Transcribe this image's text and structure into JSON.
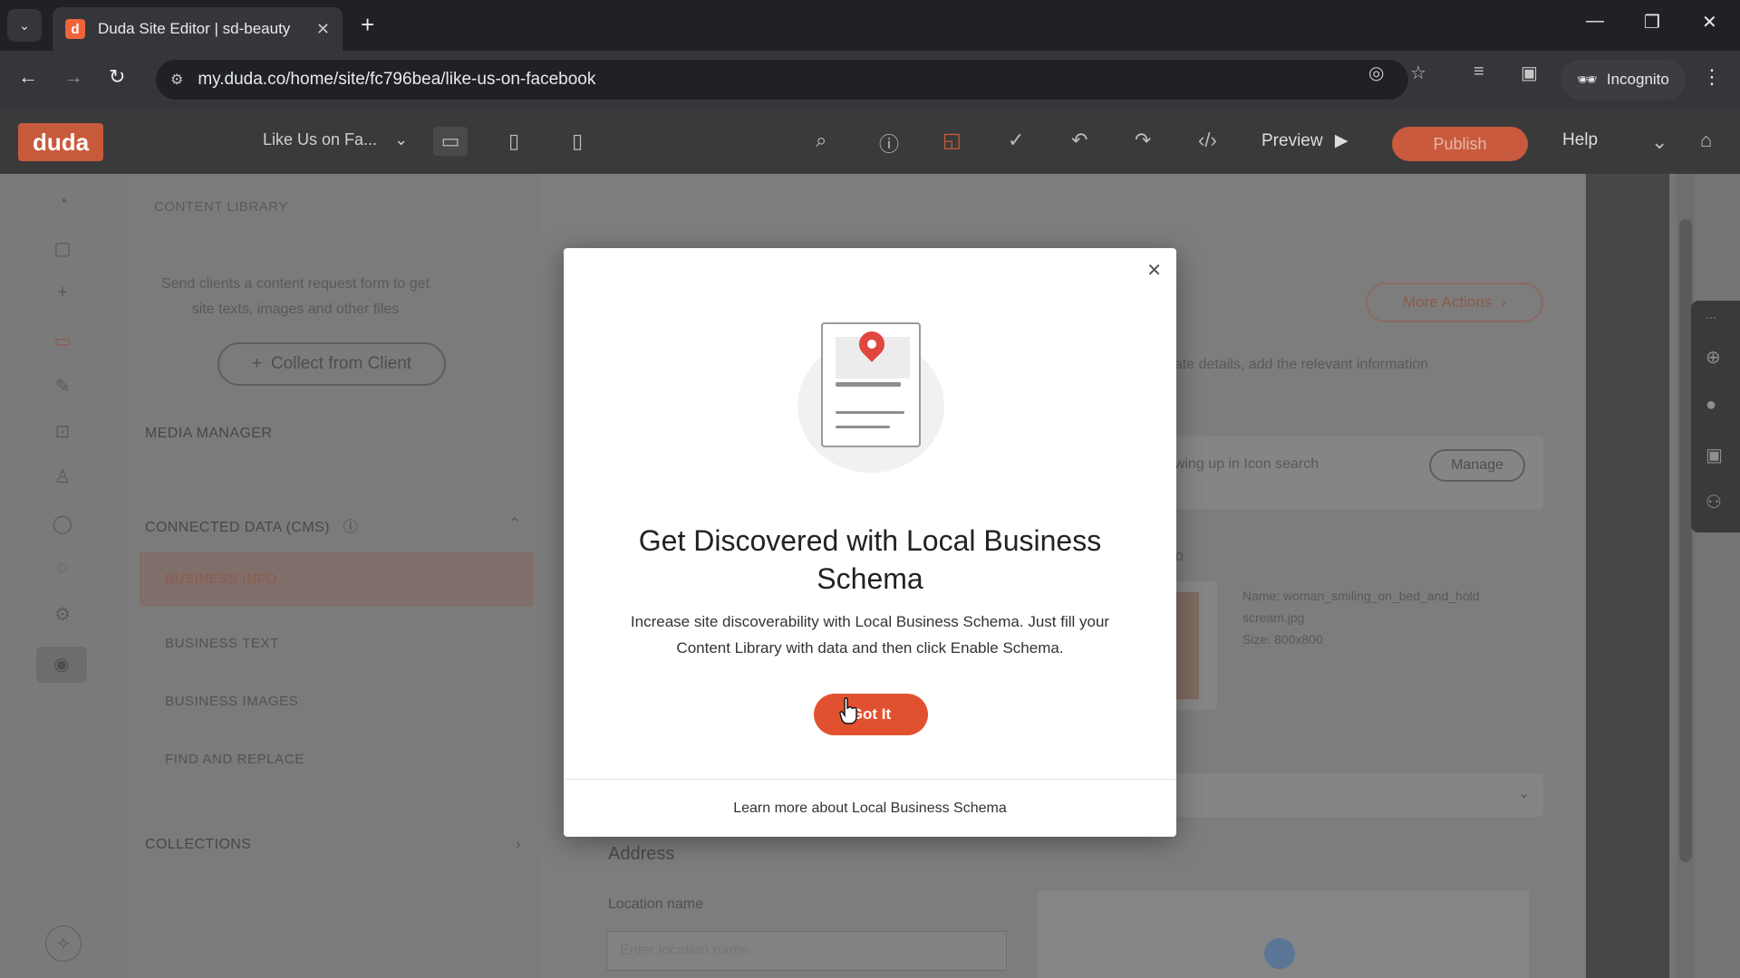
{
  "browser": {
    "tab_title": "Duda Site Editor | sd-beauty",
    "url": "my.duda.co/home/site/fc796bea/like-us-on-facebook",
    "incognito_label": "Incognito"
  },
  "editor": {
    "logo": "duda",
    "page_selector": "Like Us on Fa...",
    "preview_label": "Preview",
    "publish_label": "Publish",
    "help_label": "Help"
  },
  "panel": {
    "header": "CONTENT LIBRARY",
    "subtext": "Send clients a content request form to get site texts, images and other files",
    "collect_button": "Collect from Client",
    "media_manager": "MEDIA MANAGER",
    "connected_data": "CONNECTED DATA (CMS)",
    "items": [
      "BUSINESS INFO",
      "BUSINESS TEXT",
      "BUSINESS IMAGES",
      "FIND AND REPLACE"
    ],
    "collections": "COLLECTIONS"
  },
  "canvas": {
    "more_actions": "More Actions",
    "update_text": "date details, add the relevant information",
    "search_text": "owing up in Icon search",
    "manage_button": "Manage",
    "logo_label": "go",
    "file_info_name": "Name: woman_smiling_on_bed_and_hold",
    "file_info_file": "scream.jpg",
    "file_info_size": "Size: 800x800",
    "address_heading": "Address",
    "location_label": "Location name",
    "location_placeholder": "Enter location name"
  },
  "modal": {
    "title": "Get Discovered with Local Business Schema",
    "description": "Increase site discoverability with Local Business Schema. Just fill your Content Library with data and then click Enable Schema.",
    "button": "Got It",
    "footer_link": "Learn more about Local Business Schema"
  },
  "colors": {
    "accent": "#e2512f",
    "overlay": "#757575"
  }
}
